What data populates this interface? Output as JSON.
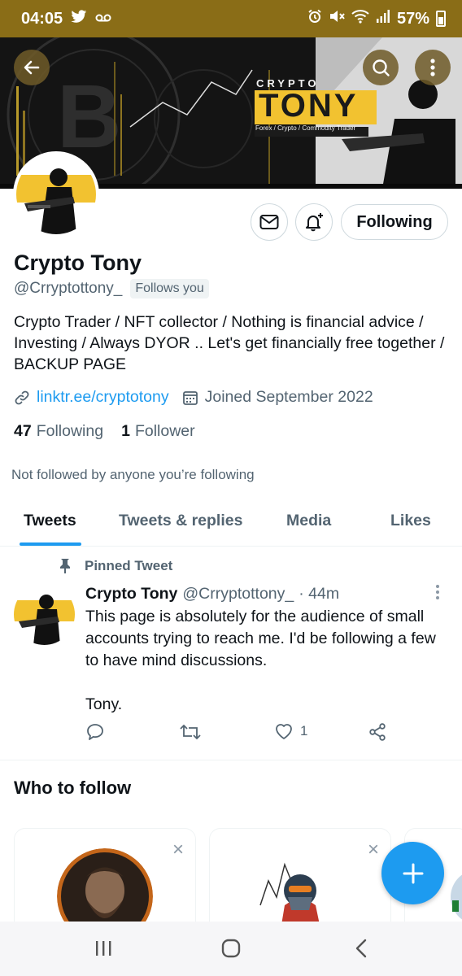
{
  "status_bar": {
    "time": "04:05",
    "battery": "57%",
    "icons": [
      "twitter-bird-icon",
      "voicemail-icon",
      "alarm-icon",
      "mute-icon",
      "wifi-icon",
      "signal-icon",
      "battery-icon"
    ]
  },
  "banner": {
    "title_small": "CRYPTO",
    "title_big": "TONY",
    "subtitle": "Forex / Crypto / Commodity Trader"
  },
  "profile": {
    "name": "Crypto Tony",
    "handle": "@Crryptottony_",
    "follows_you": "Follows you",
    "bio": "Crypto Trader / NFT collector / Nothing is financial advice / Investing / Always DYOR .. Let's get financially free together / BACKUP PAGE",
    "link": "linktr.ee/cryptotony",
    "joined": "Joined September 2022",
    "following_count": "47",
    "following_label": "Following",
    "followers_count": "1",
    "followers_label": "Follower",
    "not_followed": "Not followed by anyone you’re following",
    "follow_button": "Following"
  },
  "tabs": [
    {
      "label": "Tweets",
      "active": true
    },
    {
      "label": "Tweets & replies",
      "active": false
    },
    {
      "label": "Media",
      "active": false
    },
    {
      "label": "Likes",
      "active": false
    }
  ],
  "pinned_tweet": {
    "pinned_label": "Pinned Tweet",
    "author": "Crypto Tony",
    "handle": "@Crryptottony_",
    "time": "· 44m",
    "text": "This page is absolutely for the audience of small accounts trying to reach me. I'd be following a few to have mind discussions.\n\nTony.",
    "likes": "1"
  },
  "who_to_follow": {
    "title": "Who to follow",
    "dismiss": "×"
  },
  "fab": {
    "label": "+"
  },
  "colors": {
    "status_bar": "#8a6d17",
    "accent": "#1d9bf0",
    "banner_yellow": "#f2c230"
  }
}
